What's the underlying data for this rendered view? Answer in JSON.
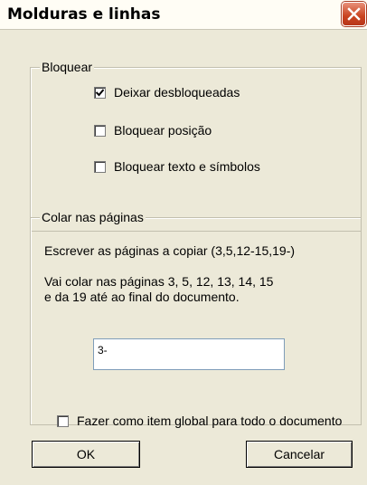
{
  "window": {
    "title": "Molduras e linhas",
    "close_icon": "close-icon",
    "close_color": "#d65c3c"
  },
  "bloquear": {
    "legend": "Bloquear",
    "options": [
      {
        "label": "Deixar desbloqueadas",
        "checked": true
      },
      {
        "label": "Bloquear posição",
        "checked": false
      },
      {
        "label": "Bloquear texto e símbolos",
        "checked": false
      }
    ]
  },
  "colar": {
    "legend": "Colar nas páginas",
    "instruction": "Escrever as páginas a copiar (3,5,12-15,19-)",
    "result_line1": "Vai colar nas páginas 3, 5, 12, 13, 14, 15",
    "result_line2": "e da 19 até ao final do documento.",
    "input_value": "3-"
  },
  "global_option": {
    "label": "Fazer como item global para todo o documento",
    "checked": false
  },
  "buttons": {
    "ok": "OK",
    "cancel": "Cancelar"
  }
}
